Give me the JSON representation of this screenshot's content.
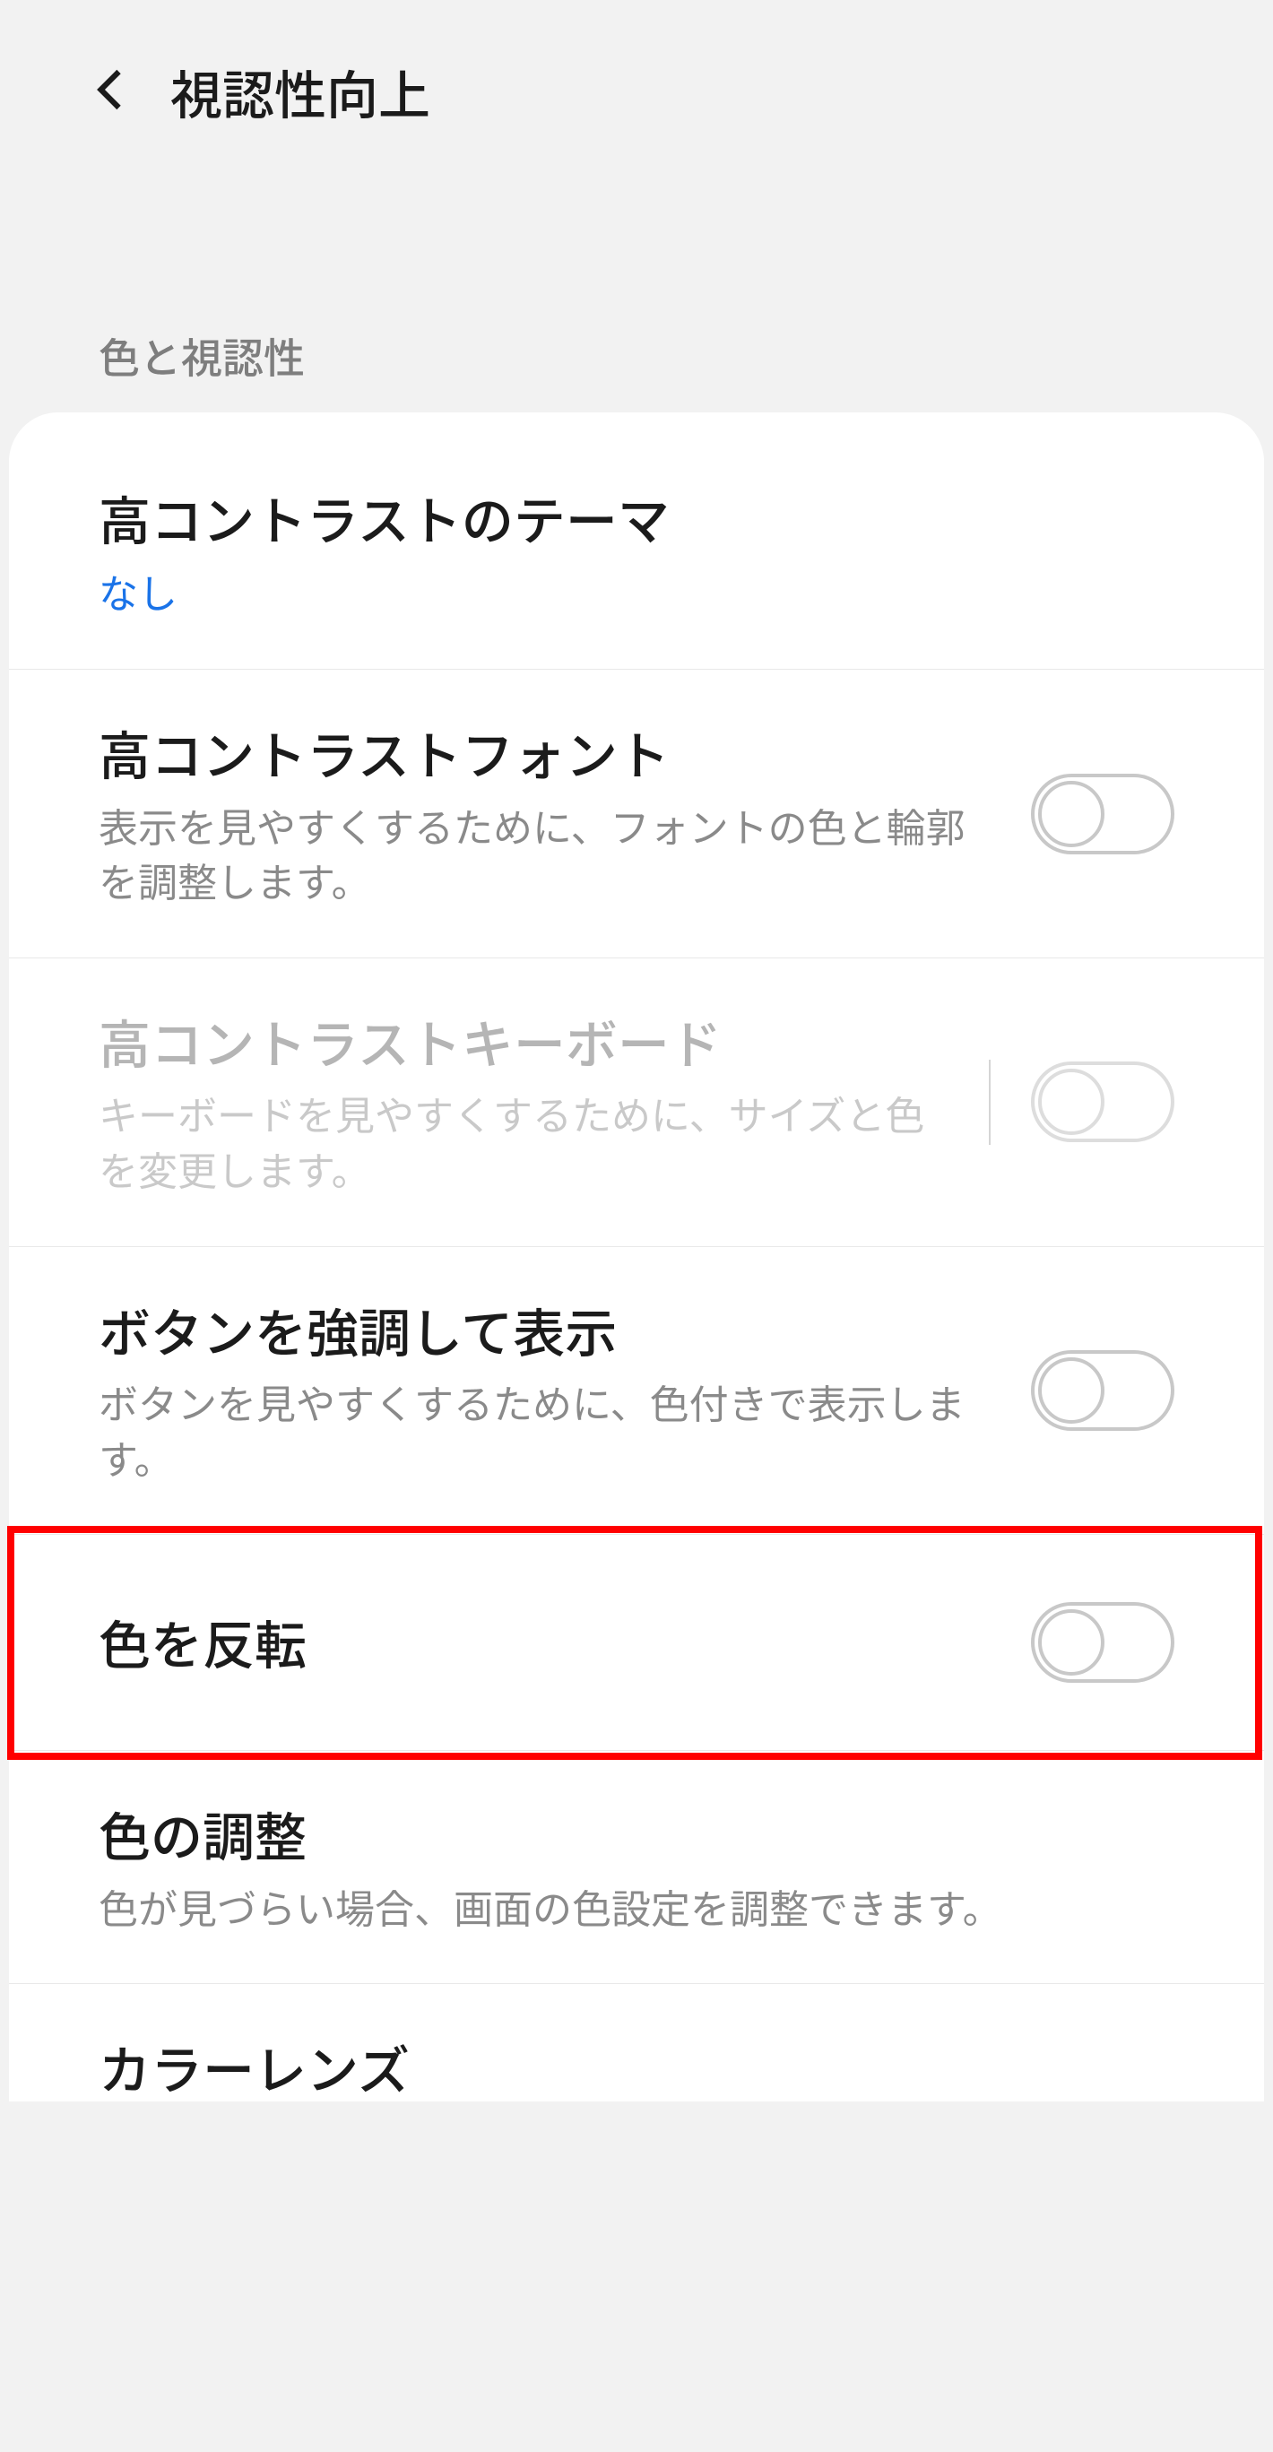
{
  "header": {
    "title": "視認性向上"
  },
  "section": {
    "label": "色と視認性"
  },
  "items": {
    "theme": {
      "title": "高コントラストのテーマ",
      "value": "なし"
    },
    "font": {
      "title": "高コントラストフォント",
      "sub": "表示を見やすくするために、フォントの色と輪郭を調整します。"
    },
    "keyboard": {
      "title": "高コントラストキーボード",
      "sub": "キーボードを見やすくするために、サイズと色を変更します。"
    },
    "button": {
      "title": "ボタンを強調して表示",
      "sub": "ボタンを見やすくするために、色付きで表示します。"
    },
    "invert": {
      "title": "色を反転"
    },
    "adjust": {
      "title": "色の調整",
      "sub": "色が見づらい場合、画面の色設定を調整できます。"
    },
    "lens": {
      "title": "カラーレンズ"
    }
  }
}
